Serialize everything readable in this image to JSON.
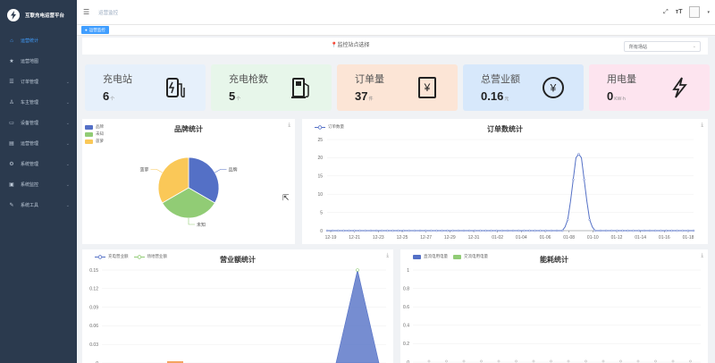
{
  "app": {
    "title": "互联充电运营平台"
  },
  "sidebar": {
    "items": [
      {
        "label": "运营统计",
        "icon": "home-icon",
        "active": true,
        "arrow": false
      },
      {
        "label": "运营地图",
        "icon": "star-icon",
        "active": false,
        "arrow": false
      },
      {
        "label": "订单管理",
        "icon": "list-icon",
        "active": false,
        "arrow": true
      },
      {
        "label": "车主管理",
        "icon": "user-icon",
        "active": false,
        "arrow": true
      },
      {
        "label": "设备管理",
        "icon": "device-icon",
        "active": false,
        "arrow": true
      },
      {
        "label": "运营管理",
        "icon": "operation-icon",
        "active": false,
        "arrow": true
      },
      {
        "label": "系统管理",
        "icon": "gear-icon",
        "active": false,
        "arrow": true
      },
      {
        "label": "系统监控",
        "icon": "monitor-icon",
        "active": false,
        "arrow": true
      },
      {
        "label": "系统工具",
        "icon": "tool-icon",
        "active": false,
        "arrow": true
      }
    ]
  },
  "header": {
    "breadcrumb": "运营监控"
  },
  "tags": {
    "active": "运营监控"
  },
  "filter": {
    "label": "监控站点选择",
    "select_value": "所有场站"
  },
  "cards": [
    {
      "label": "充电站",
      "value": "6",
      "unit": "个",
      "bg": "#e6f0fb",
      "icon": "ev-charger-icon"
    },
    {
      "label": "充电枪数",
      "value": "5",
      "unit": "个",
      "bg": "#e7f6ea",
      "icon": "fuel-pump-icon"
    },
    {
      "label": "订单量",
      "value": "37",
      "unit": "件",
      "bg": "#fce5d6",
      "icon": "receipt-icon"
    },
    {
      "label": "总营业额",
      "value": "0.16",
      "unit": "元",
      "bg": "#d7e8fb",
      "icon": "yen-circle-icon"
    },
    {
      "label": "用电量",
      "value": "0",
      "unit": "KW·h",
      "bg": "#fde4ef",
      "icon": "lightning-icon"
    }
  ],
  "brand_panel": {
    "title": "品牌统计",
    "legend": [
      {
        "name": "品牌",
        "color": "#5470c6"
      },
      {
        "name": "未知",
        "color": "#91cc75"
      },
      {
        "name": "菠萝",
        "color": "#fac858"
      }
    ],
    "chart_data": {
      "type": "pie",
      "slices": [
        {
          "name": "品牌",
          "value": 2,
          "color": "#5470c6"
        },
        {
          "name": "未知",
          "value": 2,
          "color": "#91cc75"
        },
        {
          "name": "菠萝",
          "value": 2,
          "color": "#fac858"
        }
      ]
    }
  },
  "order_panel": {
    "title": "订单数统计",
    "chart_data": {
      "type": "line",
      "series": [
        {
          "name": "订单数量",
          "color": "#5470c6",
          "values": [
            0,
            0,
            0,
            0,
            0,
            0,
            0,
            0,
            0,
            0,
            0,
            0,
            0,
            0,
            0,
            0,
            0,
            0,
            0,
            0,
            0,
            0,
            0,
            0,
            0,
            0,
            0,
            0,
            0,
            0,
            0,
            0,
            0,
            0,
            0,
            0,
            0,
            0,
            0,
            0,
            0,
            0,
            0,
            0,
            0,
            0,
            0,
            0,
            0,
            0,
            0,
            0,
            0,
            0,
            0,
            0,
            0,
            0,
            0,
            0,
            0,
            0,
            0,
            0,
            0,
            0,
            0,
            0,
            0,
            0,
            0,
            0,
            0,
            0,
            0,
            0,
            0,
            0,
            0,
            0,
            0,
            0,
            0,
            0,
            0,
            0,
            0,
            1,
            3,
            8,
            14,
            20,
            21,
            20,
            14,
            8,
            3,
            1,
            0,
            0,
            0,
            0,
            0,
            0,
            0,
            0,
            0,
            0,
            0,
            0,
            0,
            0,
            0,
            0,
            0,
            0,
            0,
            0,
            0,
            0,
            0,
            0,
            0,
            0,
            0,
            0,
            0,
            0,
            0,
            0,
            0,
            0,
            0,
            0,
            0
          ]
        }
      ],
      "categories": [
        "12-19",
        "12-21",
        "12-23",
        "12-25",
        "12-27",
        "12-29",
        "12-31",
        "01-02",
        "01-04",
        "01-06",
        "01-08",
        "01-10",
        "01-12",
        "01-14",
        "01-16",
        "01-18"
      ],
      "yticks": [
        0,
        5,
        10,
        15,
        20,
        25
      ],
      "ylim": [
        0,
        25
      ]
    }
  },
  "revenue_panel": {
    "title": "营业额统计",
    "chart_data": {
      "type": "area",
      "series": [
        {
          "name": "充电营业额",
          "color": "#5470c6"
        },
        {
          "name": "场地营业额",
          "color": "#91cc75"
        }
      ],
      "yticks": [
        "0",
        "0.03",
        "0.06",
        "0.09",
        "0.12",
        "0.15"
      ],
      "ylim": [
        0,
        0.15
      ],
      "peak": 0.15
    }
  },
  "energy_panel": {
    "title": "能耗统计",
    "chart_data": {
      "type": "bar",
      "series": [
        {
          "name": "直流电用电量",
          "color": "#5470c6"
        },
        {
          "name": "交流电用电量",
          "color": "#91cc75"
        }
      ],
      "yticks": [
        "0",
        "0.2",
        "0.4",
        "0.6",
        "0.8",
        "1"
      ],
      "ylim": [
        0,
        1
      ]
    }
  }
}
